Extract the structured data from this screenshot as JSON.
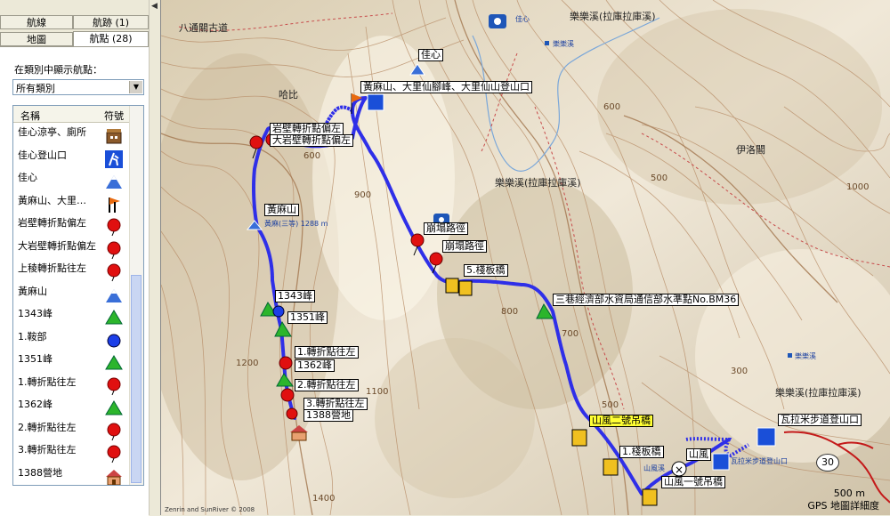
{
  "panel": {
    "tabs": [
      {
        "label": "航線"
      },
      {
        "label": "航跡 (1)"
      },
      {
        "label": "地圖"
      },
      {
        "label": "航點 (28)"
      }
    ],
    "filter_label": "在類別中顯示航點：",
    "filter_value": "所有類別",
    "list_headers": {
      "name": "名稱",
      "symbol": "符號"
    },
    "waypoints": [
      {
        "name": "佳心涼亭、廁所",
        "symbol": "building-icon"
      },
      {
        "name": "佳心登山口",
        "symbol": "hiker-icon"
      },
      {
        "name": "佳心",
        "symbol": "mountain-icon"
      },
      {
        "name": "黃麻山、大里…",
        "symbol": "flags-icon"
      },
      {
        "name": "岩壁轉折點偏左",
        "symbol": "red-pin-icon"
      },
      {
        "name": "大岩壁轉折點偏左",
        "symbol": "red-pin-icon"
      },
      {
        "name": "上稜轉折點往左",
        "symbol": "red-pin-icon"
      },
      {
        "name": "黃麻山",
        "symbol": "mountain-icon"
      },
      {
        "name": "1343峰",
        "symbol": "green-summit-icon"
      },
      {
        "name": "1.鞍部",
        "symbol": "blue-dot-icon"
      },
      {
        "name": "1351峰",
        "symbol": "green-summit-icon"
      },
      {
        "name": "1.轉折點往左",
        "symbol": "red-pin-icon"
      },
      {
        "name": "1362峰",
        "symbol": "green-summit-icon"
      },
      {
        "name": "2.轉折點往左",
        "symbol": "red-pin-icon"
      },
      {
        "name": "3.轉折點往左",
        "symbol": "red-pin-icon"
      },
      {
        "name": "1388營地",
        "symbol": "house-icon"
      }
    ]
  },
  "map": {
    "place_labels": [
      {
        "text": "八通關古道"
      },
      {
        "text": "哈比"
      },
      {
        "text": "伊洛閣"
      },
      {
        "text": "樂樂溪(拉庫拉庫溪)"
      },
      {
        "text": "樂樂溪"
      },
      {
        "text": "樂樂溪(拉庫拉庫溪)"
      },
      {
        "text": "樂樂溪(拉庫拉庫溪)"
      },
      {
        "text": "樂樂溪"
      },
      {
        "text": "佳心"
      }
    ],
    "waypoint_labels": [
      {
        "text": "佳心"
      },
      {
        "text": "黃麻山、大里仙腳峰、大里仙山登山口"
      },
      {
        "text": "岩壁轉折點偏左"
      },
      {
        "text": "大岩壁轉折點偏左"
      },
      {
        "text": "黃麻山"
      },
      {
        "text": "黃麻(三等) 1288 m"
      },
      {
        "text": "崩塌路徑"
      },
      {
        "text": "崩塌路徑"
      },
      {
        "text": "5.棧板橋"
      },
      {
        "text": "1343峰"
      },
      {
        "text": "1351峰"
      },
      {
        "text": "三巷經濟部水資局通信部水準點No.BM36"
      },
      {
        "text": "1.轉折點往左"
      },
      {
        "text": "1362峰"
      },
      {
        "text": "2.轉折點往左"
      },
      {
        "text": "3.轉折點往左"
      },
      {
        "text": "1388營地"
      },
      {
        "text": "山風二號吊橋"
      },
      {
        "text": "1.棧板橋"
      },
      {
        "text": "山風"
      },
      {
        "text": "山風一號吊橋"
      },
      {
        "text": "瓦拉米步道登山口"
      },
      {
        "text": "瓦拉米步道登山口"
      },
      {
        "text": "山風溪"
      }
    ],
    "contours": [
      "600",
      "500",
      "1000",
      "800",
      "900",
      "700",
      "600",
      "500",
      "300",
      "1200",
      "1400",
      "1100"
    ],
    "route_shield": "30",
    "scale": "500 m",
    "detail_label": "GPS 地圖詳細度",
    "copyright": "Zenrin and SunRiver © 2008"
  },
  "colors": {
    "track": "#2f2fe8",
    "contour": "#b98f6a",
    "terrain": "#e8dcc4"
  }
}
